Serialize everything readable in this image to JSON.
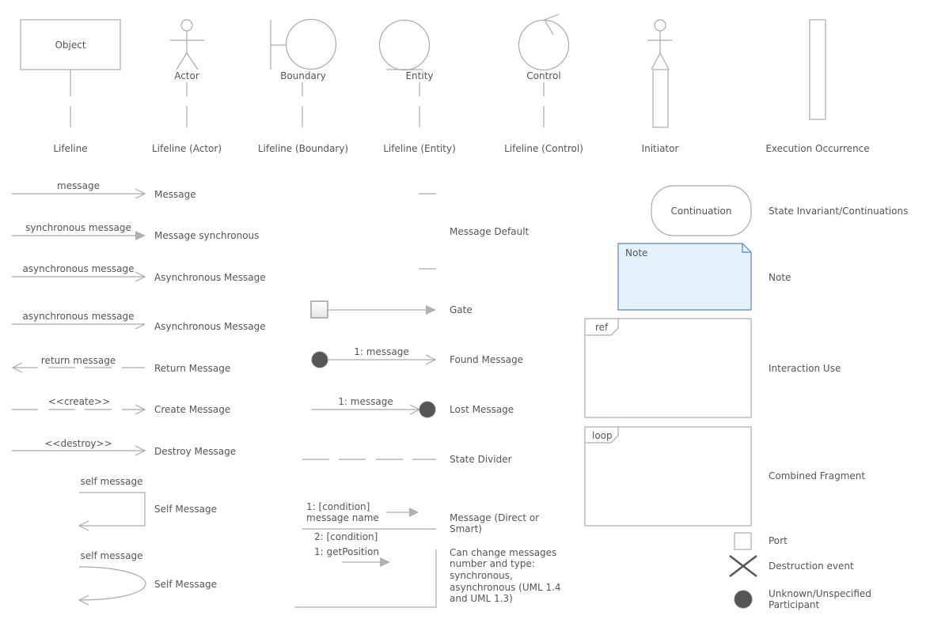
{
  "lifelines": {
    "object": {
      "shape_label": "Object",
      "caption": "Lifeline"
    },
    "actor": {
      "shape_label": "Actor",
      "caption": "Lifeline (Actor)"
    },
    "boundary": {
      "shape_label": "Boundary",
      "caption": "Lifeline (Boundary)"
    },
    "entity": {
      "shape_label": "Entity",
      "caption": "Lifeline (Entity)"
    },
    "control": {
      "shape_label": "Control",
      "caption": "Lifeline (Control)"
    },
    "initiator": {
      "caption": "Initiator"
    },
    "execution": {
      "caption": "Execution Occurrence"
    }
  },
  "messages": {
    "message": {
      "text": "message",
      "caption": "Message"
    },
    "synchronous": {
      "text": "synchronous message",
      "caption": "Message synchronous"
    },
    "asynchronous1": {
      "text": "asynchronous message",
      "caption": "Asynchronous Message"
    },
    "asynchronous2": {
      "text": "asynchronous message",
      "caption": "Asynchronous Message"
    },
    "return": {
      "text": "return message",
      "caption": "Return Message"
    },
    "create": {
      "text": "<<create>>",
      "caption": "Create Message"
    },
    "destroy": {
      "text": "<<destroy>>",
      "caption": "Destroy Message"
    },
    "self1": {
      "text": "self message",
      "caption": "Self Message"
    },
    "self2": {
      "text": "self message",
      "caption": "Self Message"
    }
  },
  "middle": {
    "default": {
      "caption": "Message Default"
    },
    "gate": {
      "caption": "Gate"
    },
    "found": {
      "text": "1: message",
      "caption": "Found Message"
    },
    "lost": {
      "text": "1: message",
      "caption": "Lost Message"
    },
    "divider": {
      "caption": "State Divider"
    },
    "direct": {
      "line1": "1: [condition]",
      "line2": "message name",
      "line3": "2: [condition]",
      "caption_line1": "Message (Direct or",
      "caption_line2": "Smart)"
    },
    "change": {
      "text": "1: getPosition",
      "caption_lines": [
        "Can change messages",
        "number and type:",
        "synchronous,",
        "asynchronous (UML 1.4",
        "and UML 1.3)"
      ]
    }
  },
  "right": {
    "continuation": {
      "shape_label": "Continuation",
      "caption": "State Invariant/Continuations"
    },
    "note": {
      "shape_label": "Note",
      "caption": "Note"
    },
    "interaction_use": {
      "tag": "ref",
      "caption": "Interaction Use"
    },
    "combined_fragment": {
      "tag": "loop",
      "caption": "Combined Fragment"
    },
    "port": {
      "caption": "Port"
    },
    "destruction": {
      "caption": "Destruction event"
    },
    "unknown": {
      "caption_line1": "Unknown/Unspecified",
      "caption_line2": "Participant"
    }
  },
  "colors": {
    "line": "#aaaaaa",
    "text": "#555555",
    "note_fill": "#e5f2fc",
    "note_stroke": "#5b86c5",
    "dark_fill": "#555555"
  }
}
